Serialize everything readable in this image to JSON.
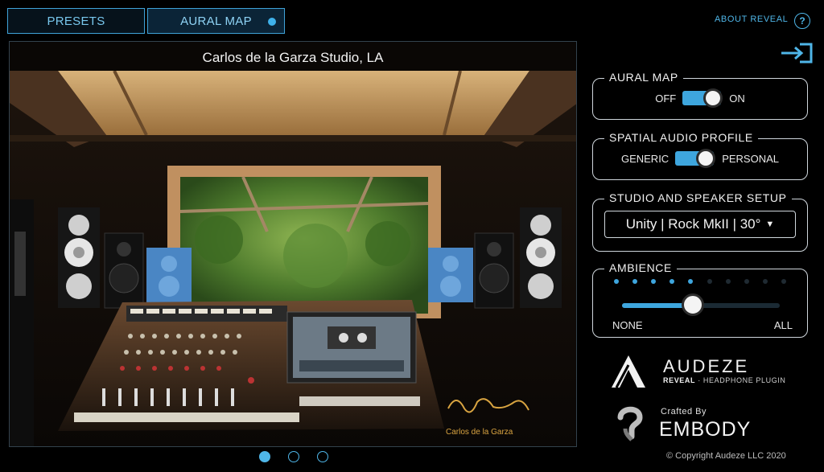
{
  "tabs": {
    "presets": "PRESETS",
    "aural_map": "AURAL MAP"
  },
  "header": {
    "about": "ABOUT REVEAL",
    "help_icon": "?"
  },
  "stage": {
    "title": "Carlos de la Garza Studio, LA",
    "signature_caption": "Carlos de la Garza"
  },
  "carousel": {
    "pages": 3,
    "active_index": 0
  },
  "aural_map": {
    "title": "AURAL MAP",
    "off_label": "OFF",
    "on_label": "ON",
    "state": "on"
  },
  "spatial_profile": {
    "title": "SPATIAL AUDIO PROFILE",
    "left_label": "GENERIC",
    "right_label": "PERSONAL",
    "state": "personal"
  },
  "studio_setup": {
    "title": "STUDIO AND SPEAKER SETUP",
    "selected": "Unity | Rock MkII | 30°"
  },
  "ambience": {
    "title": "AMBIENCE",
    "min_label": "NONE",
    "max_label": "ALL",
    "level": 0.45,
    "steps_total": 10,
    "steps_on": 5
  },
  "brand": {
    "audeze_name": "AUDEZE",
    "audeze_sub_bold": "REVEAL",
    "audeze_sub_rest": " · HEADPHONE PLUGIN",
    "crafted_by": "Crafted By",
    "embody_name": "EMBODY"
  },
  "copyright": "© Copyright Audeze LLC 2020",
  "colors": {
    "accent": "#3ea6de",
    "tab_border": "#3fa3d9",
    "panel_border": "#cfd6dc"
  }
}
